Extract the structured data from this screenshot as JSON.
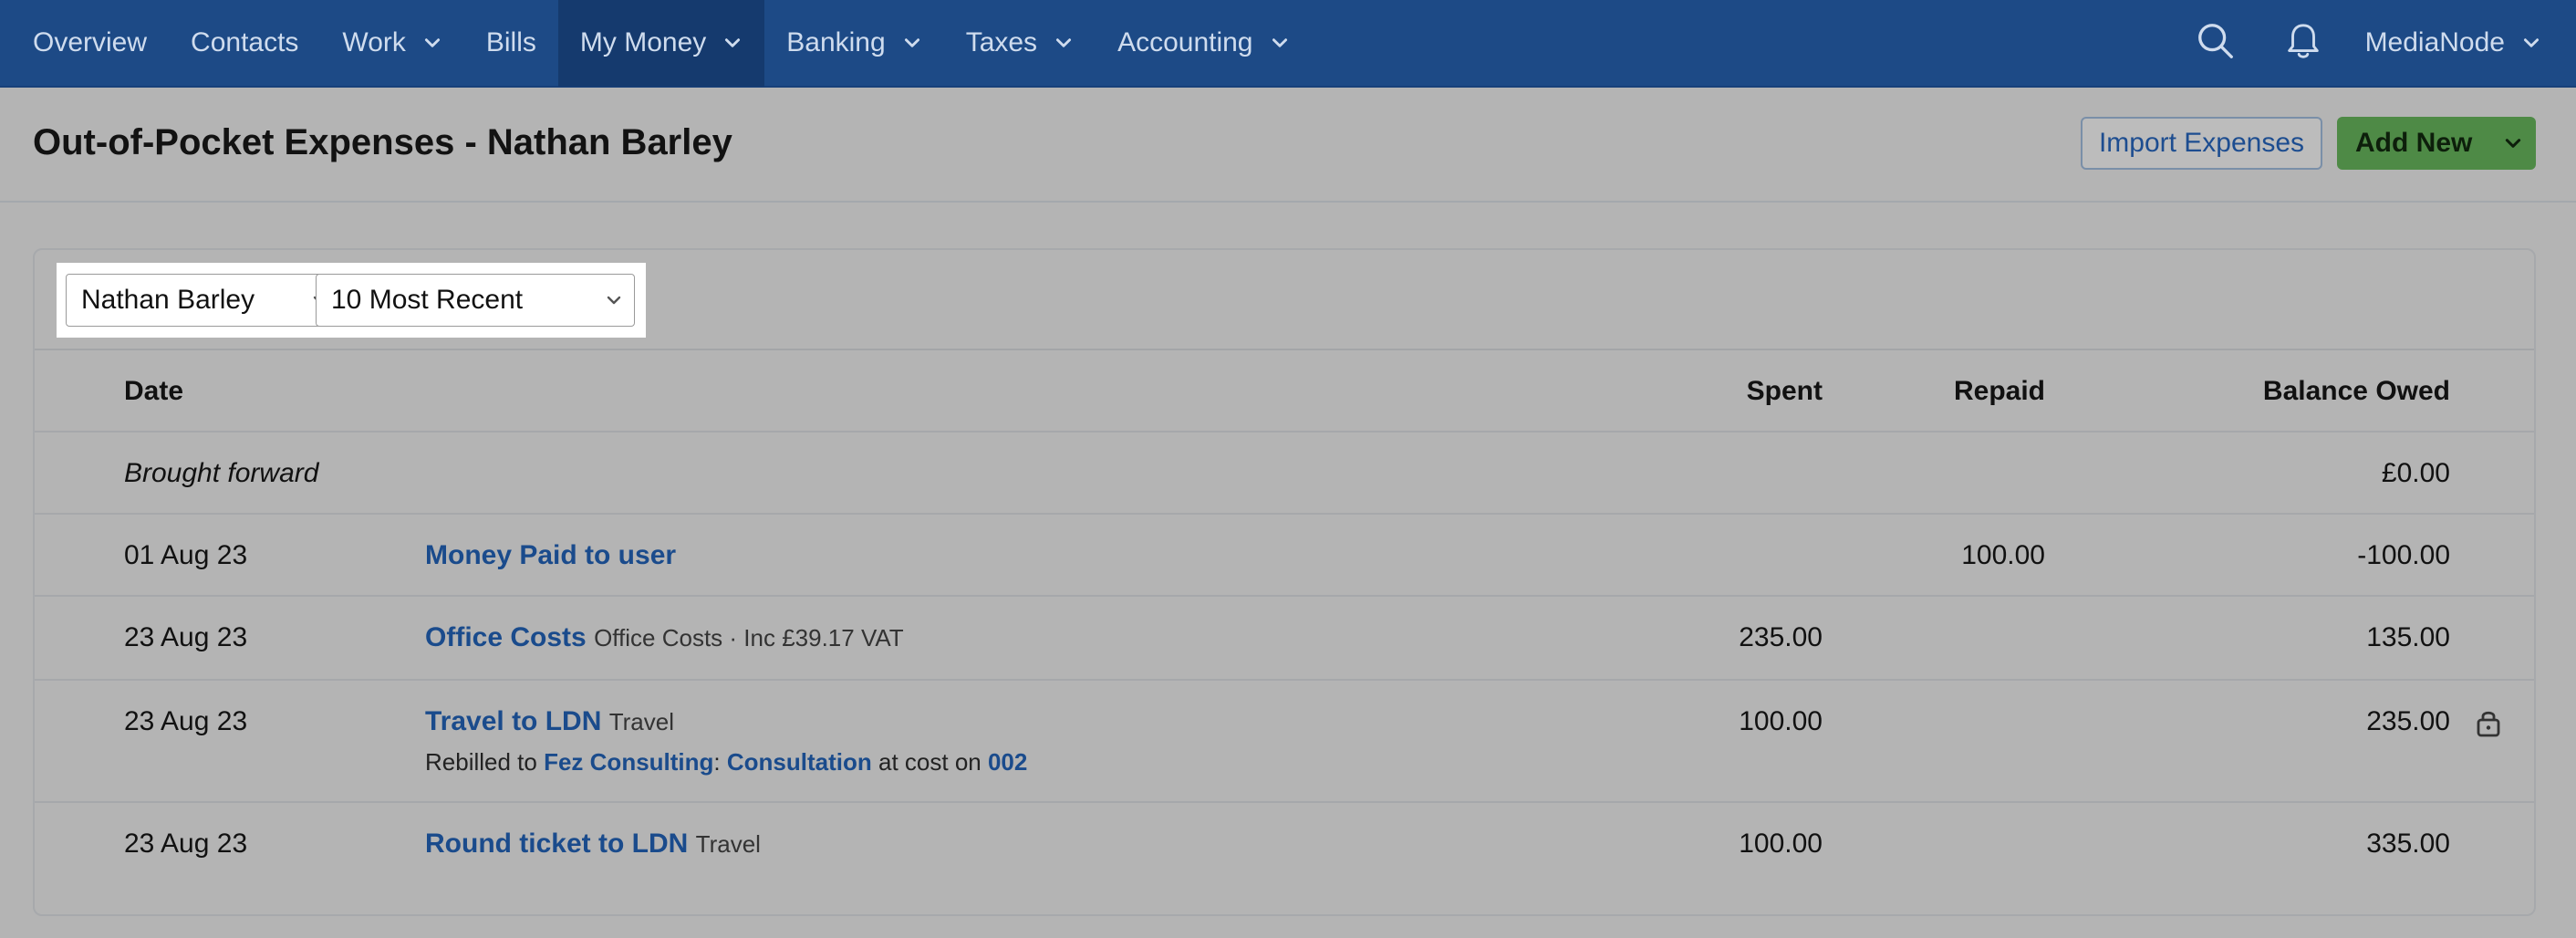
{
  "nav": {
    "items": [
      {
        "label": "Overview",
        "dropdown": false
      },
      {
        "label": "Contacts",
        "dropdown": false
      },
      {
        "label": "Work",
        "dropdown": true
      },
      {
        "label": "Bills",
        "dropdown": false
      },
      {
        "label": "My Money",
        "dropdown": true,
        "active": true
      },
      {
        "label": "Banking",
        "dropdown": true
      },
      {
        "label": "Taxes",
        "dropdown": true
      },
      {
        "label": "Accounting",
        "dropdown": true
      }
    ],
    "account_label": "MediaNode"
  },
  "page": {
    "title": "Out-of-Pocket Expenses - Nathan Barley",
    "import_label": "Import Expenses",
    "add_label": "Add New"
  },
  "filters": {
    "user": "Nathan Barley",
    "range": "10 Most Recent"
  },
  "table": {
    "headers": {
      "date": "Date",
      "spent": "Spent",
      "repaid": "Repaid",
      "balance": "Balance Owed"
    },
    "brought_forward": {
      "label": "Brought forward",
      "balance": "£0.00"
    },
    "rows": [
      {
        "date": "01 Aug 23",
        "desc": "Money Paid to user",
        "meta": "",
        "spent": "",
        "repaid": "100.00",
        "balance": "-100.00"
      },
      {
        "date": "23 Aug 23",
        "desc": "Office Costs",
        "meta": "Office Costs · Inc £39.17 VAT",
        "spent": "235.00",
        "repaid": "",
        "balance": "135.00"
      },
      {
        "date": "23 Aug 23",
        "desc": "Travel to LDN",
        "meta": "Travel",
        "spent": "100.00",
        "repaid": "",
        "balance": "235.00",
        "rebill": {
          "prefix": "Rebilled to",
          "client": "Fez Consulting",
          "sep": ":",
          "project": "Consultation",
          "mid": "at cost on",
          "invoice": "002"
        }
      },
      {
        "date": "23 Aug 23",
        "desc": "Round ticket to LDN",
        "meta": "Travel",
        "spent": "100.00",
        "repaid": "",
        "balance": "335.00"
      }
    ]
  },
  "colors": {
    "nav_bg": "#1d4a86",
    "nav_active": "#153a6e",
    "link": "#1a4b8c",
    "add_button": "#4e8a46",
    "overlay_bg": "#b4b4b4"
  },
  "icons": [
    "chevron-down-icon",
    "search-icon",
    "bell-icon",
    "lock-icon"
  ]
}
